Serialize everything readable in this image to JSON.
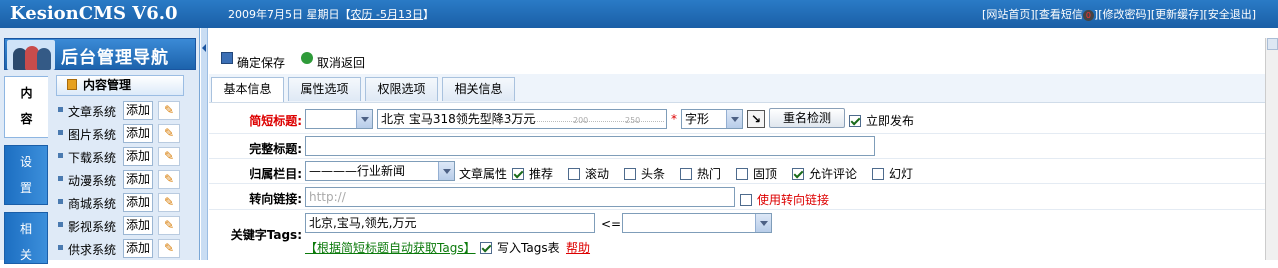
{
  "header": {
    "app_title": "KesionCMS V6.0",
    "date_prefix": "2009年7月5日  星期日【",
    "lunar_link": "农历 -5月13日",
    "date_suffix": "】",
    "links": {
      "home": "[网站首页]",
      "messages_pre": "[查看短信",
      "messages_count": "0",
      "messages_post": "]",
      "password": "[修改密码]",
      "cache": "[更新缓存]",
      "logout": "[安全退出]"
    }
  },
  "sidebar": {
    "title": "后台管理导航",
    "vtabs": [
      {
        "label": "内容"
      },
      {
        "label": "设置"
      },
      {
        "label": "相关"
      }
    ],
    "section_title": "内容管理",
    "add_label": "添加",
    "items": [
      {
        "label": "文章系统"
      },
      {
        "label": "图片系统"
      },
      {
        "label": "下载系统"
      },
      {
        "label": "动漫系统"
      },
      {
        "label": "商城系统"
      },
      {
        "label": "影视系统"
      },
      {
        "label": "供求系统"
      }
    ]
  },
  "toolbar": {
    "save": "确定保存",
    "cancel": "取消返回"
  },
  "tabs": [
    {
      "label": "基本信息",
      "active": true
    },
    {
      "label": "属性选项"
    },
    {
      "label": "权限选项"
    },
    {
      "label": "相关信息"
    }
  ],
  "form": {
    "short_title": {
      "label": "简短标题:",
      "value": "北京 宝马318领先型降3万元",
      "ruler_200": "200",
      "ruler_250": "250",
      "required": "*",
      "font_select": "字形",
      "check_dup": "重名检测",
      "publish_now": "立即发布",
      "publish_checked": true
    },
    "full_title": {
      "label": "完整标题:",
      "value": ""
    },
    "category": {
      "label": "归属栏目:",
      "value": "————行业新闻",
      "attr_label": "文章属性",
      "attrs": [
        {
          "label": "推荐",
          "checked": true
        },
        {
          "label": "滚动",
          "checked": false
        },
        {
          "label": "头条",
          "checked": false
        },
        {
          "label": "热门",
          "checked": false
        },
        {
          "label": "固顶",
          "checked": false
        },
        {
          "label": "允许评论",
          "checked": true
        },
        {
          "label": "幻灯",
          "checked": false
        }
      ]
    },
    "redirect": {
      "label": "转向链接:",
      "placeholder": "http://",
      "use_redirect": "使用转向链接"
    },
    "keywords": {
      "label": "关键字Tags:",
      "value": "北京,宝马,领先,万元",
      "arrow": "<=",
      "auto_link": "【根据简短标题自动获取Tags】",
      "write_tags": "写入Tags表",
      "write_checked": true,
      "help": "帮助"
    }
  },
  "colors": {
    "accent": "#1a5fa6",
    "required": "#dd0000",
    "link_green": "#0b7a0b"
  }
}
